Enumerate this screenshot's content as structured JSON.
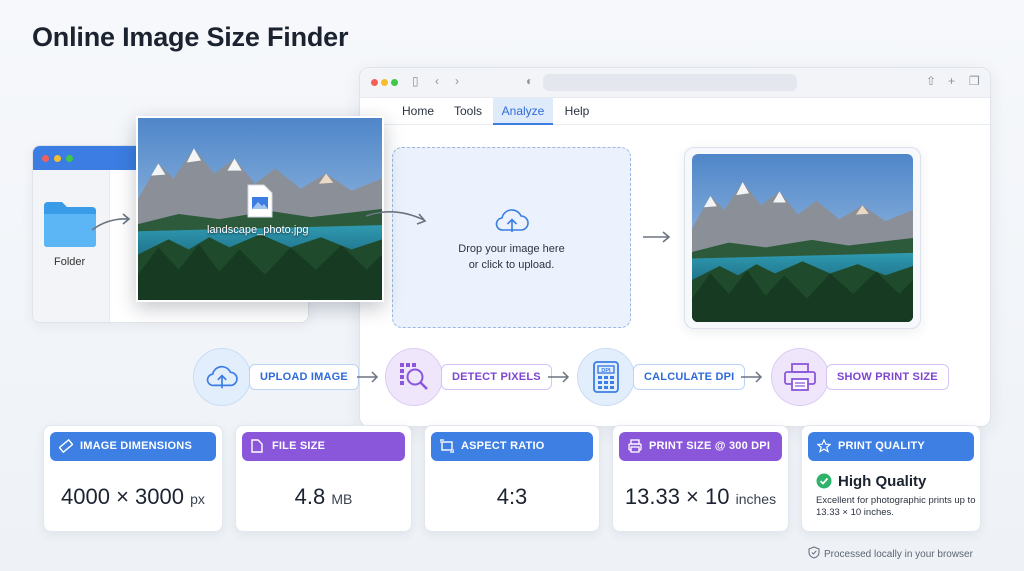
{
  "page": {
    "title": "Online Image Size Finder"
  },
  "browser": {
    "nav": [
      "Home",
      "Tools",
      "Analyze",
      "Help"
    ],
    "active_tab": "Analyze"
  },
  "upload": {
    "line1": "Drop your image here",
    "line2": "or click to upload."
  },
  "folder": {
    "label": "Folder"
  },
  "file": {
    "name": "landscape_photo.jpg"
  },
  "steps": [
    {
      "label": "UPLOAD IMAGE",
      "icon": "cloud-upload-icon"
    },
    {
      "label": "DETECT PIXELS",
      "icon": "pixel-magnifier-icon"
    },
    {
      "label": "CALCULATE DPI",
      "icon": "calculator-icon"
    },
    {
      "label": "SHOW PRINT SIZE",
      "icon": "printer-icon"
    }
  ],
  "cards": {
    "dimensions": {
      "header": "IMAGE DIMENSIONS",
      "value": "4000 × 3000",
      "unit": "px"
    },
    "file_size": {
      "header": "FILE SIZE",
      "value": "4.8",
      "unit": "MB"
    },
    "aspect": {
      "header": "ASPECT RATIO",
      "value": "4:3"
    },
    "print": {
      "header": "PRINT SIZE @ 300 DPI",
      "value": "13.33 × 10",
      "unit": "inches"
    },
    "quality": {
      "header": "PRINT QUALITY",
      "title": "High Quality",
      "desc": "Excellent for photographic prints up to 13.33 × 10 inches."
    }
  },
  "footer": {
    "note": "Processed locally in your browser"
  },
  "colors": {
    "accent_blue": "#3d7fe3",
    "accent_purple": "#8a57db",
    "success_green": "#2fb36b"
  }
}
